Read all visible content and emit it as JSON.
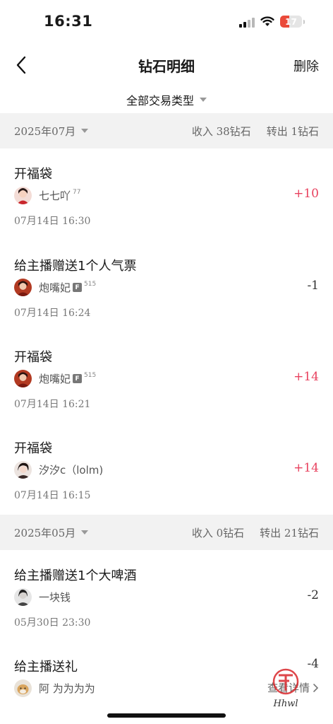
{
  "status": {
    "time": "16:31",
    "battery": "17"
  },
  "nav": {
    "title": "钻石明细",
    "delete_label": "删除"
  },
  "filter": {
    "label": "全部交易类型"
  },
  "groups": [
    {
      "month": "2025年07月",
      "income": "收入 38钻石",
      "transfer_out": "转出 1钻石",
      "items": [
        {
          "title": "开福袋",
          "user": "七七吖",
          "user_sup": "77",
          "time": "07月14日 16:30",
          "amount": "+10"
        },
        {
          "title": "给主播赠送1个人气票",
          "user": "炮嘴妃",
          "user_badge": "F",
          "user_sup": "515",
          "time": "07月14日 16:24",
          "amount": "-1"
        },
        {
          "title": "开福袋",
          "user": "炮嘴妃",
          "user_badge": "F",
          "user_sup": "515",
          "time": "07月14日 16:21",
          "amount": "+14"
        },
        {
          "title": "开福袋",
          "user": "汐汐c（lolm)",
          "time": "07月14日 16:15",
          "amount": "+14"
        }
      ]
    },
    {
      "month": "2025年05月",
      "income": "收入 0钻石",
      "transfer_out": "转出 21钻石",
      "items": [
        {
          "title": "给主播赠送1个大啤酒",
          "user": "一块钱",
          "time": "05月30日 23:30",
          "amount": "-2"
        },
        {
          "title": "给主播送礼",
          "user": "阿 为为为为",
          "amount": "-4",
          "detail_link": "查看详情"
        }
      ]
    }
  ],
  "watermark": {
    "text": "Hhwl"
  },
  "colors": {
    "positive": "#e8415e",
    "negative": "#333333",
    "section_bg": "#f2f2f2"
  },
  "icons": {
    "back": "chevron-left-icon",
    "caret": "caret-down-icon",
    "detail": "chevron-right-icon"
  }
}
